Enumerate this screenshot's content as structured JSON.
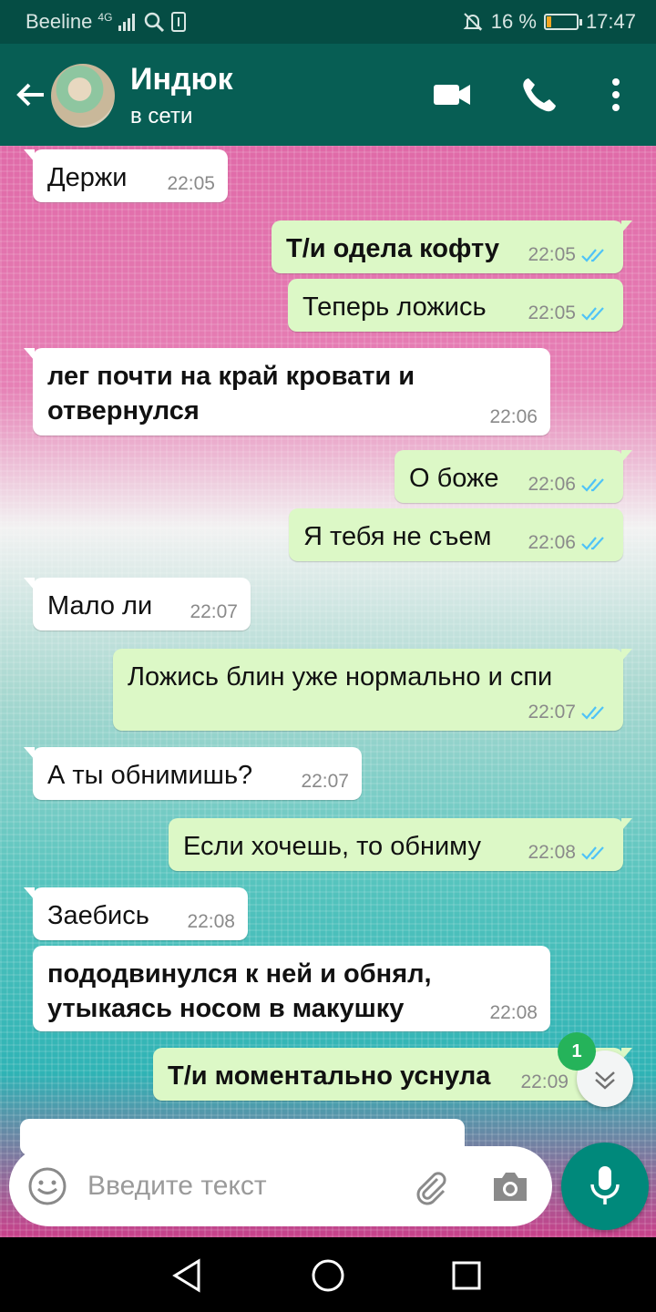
{
  "status_bar": {
    "carrier": "Beeline",
    "network": "4G",
    "battery_percent": "16 %",
    "battery_level": 0.16,
    "time": "17:47"
  },
  "header": {
    "contact_name": "Индюк",
    "contact_status": "в сети"
  },
  "messages": [
    {
      "dir": "in",
      "text": "Держи",
      "time": "22:05",
      "bold": false
    },
    {
      "dir": "out",
      "text": "Т/и одела кофту",
      "time": "22:05",
      "bold": true
    },
    {
      "dir": "out",
      "text": "Теперь ложись",
      "time": "22:05",
      "bold": false
    },
    {
      "dir": "in",
      "text": "лег почти на край кровати и отвернулся",
      "time": "22:06",
      "bold": true
    },
    {
      "dir": "out",
      "text": "О боже",
      "time": "22:06",
      "bold": false
    },
    {
      "dir": "out",
      "text": "Я тебя не съем",
      "time": "22:06",
      "bold": false
    },
    {
      "dir": "in",
      "text": "Мало ли",
      "time": "22:07",
      "bold": false
    },
    {
      "dir": "out",
      "text": "Ложись блин уже нормально и спи",
      "time": "22:07",
      "bold": false
    },
    {
      "dir": "in",
      "text": "А ты обнимишь?",
      "time": "22:07",
      "bold": false
    },
    {
      "dir": "out",
      "text": "Если хочешь, то обниму",
      "time": "22:08",
      "bold": false
    },
    {
      "dir": "in",
      "text": "Заебись",
      "time": "22:08",
      "bold": false
    },
    {
      "dir": "in",
      "text": "пододвинулся к ней и обнял, утыкаясь носом в макушку",
      "time": "22:08",
      "bold": true
    },
    {
      "dir": "out",
      "text": "Т/и моментально уснула",
      "time": "22:09",
      "bold": true
    }
  ],
  "unread_count": "1",
  "input": {
    "placeholder": "Введите текст"
  },
  "colors": {
    "header": "#075e54",
    "status_bar": "#054d44",
    "outgoing_bubble": "#dcf8c6",
    "incoming_bubble": "#ffffff",
    "ticks": "#4fc3f7",
    "mic_button": "#00897b",
    "unread_badge": "#25b35a"
  },
  "icons": [
    "back-arrow-icon",
    "video-call-icon",
    "phone-icon",
    "more-vert-icon",
    "emoji-icon",
    "attach-icon",
    "camera-icon",
    "mic-icon",
    "chevron-down-icon",
    "nav-back-icon",
    "nav-home-icon",
    "nav-recents-icon",
    "search-icon",
    "signal-icon",
    "mute-icon",
    "battery-icon"
  ]
}
